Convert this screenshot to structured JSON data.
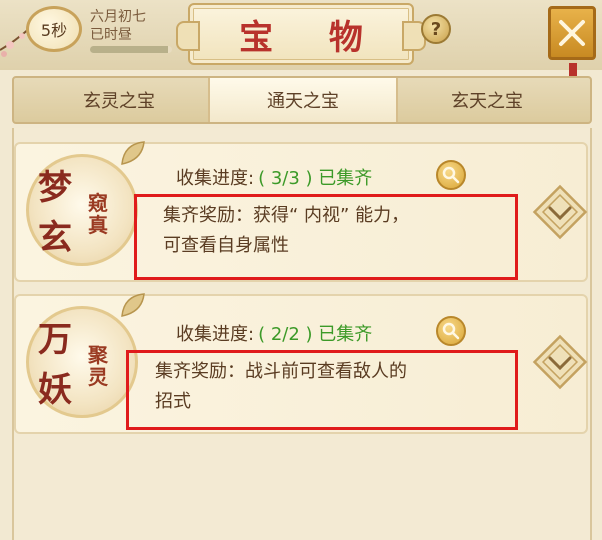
{
  "header": {
    "timer": "5秒",
    "date_line1": "六月初七",
    "date_line2": "已时昼",
    "date_progress": 0.95,
    "title": "宝 物",
    "help_label": "?"
  },
  "tabs": [
    {
      "label": "玄灵之宝",
      "active": false
    },
    {
      "label": "通天之宝",
      "active": true
    },
    {
      "label": "玄天之宝",
      "active": false
    }
  ],
  "cards": [
    {
      "medallion_big1": "梦",
      "medallion_big2": "玄",
      "medallion_small": "窥真",
      "progress_label": "收集进度:",
      "progress_value": "( 3/3 ) 已集齐",
      "reward_line1": "集齐奖励：获得“ 内视” 能力，",
      "reward_line2": "可查看自身属性"
    },
    {
      "medallion_big1": "万",
      "medallion_big2": "妖",
      "medallion_small": "聚灵",
      "progress_label": "收集进度:",
      "progress_value": "( 2/2 ) 已集齐",
      "reward_line1": "集齐奖励：战斗前可查看敌人的",
      "reward_line2": "招式"
    }
  ],
  "colors": {
    "title_red": "#b8322c",
    "complete_green": "#3c9a28",
    "highlight_red": "#e01b1b",
    "gold": "#d9a534"
  }
}
